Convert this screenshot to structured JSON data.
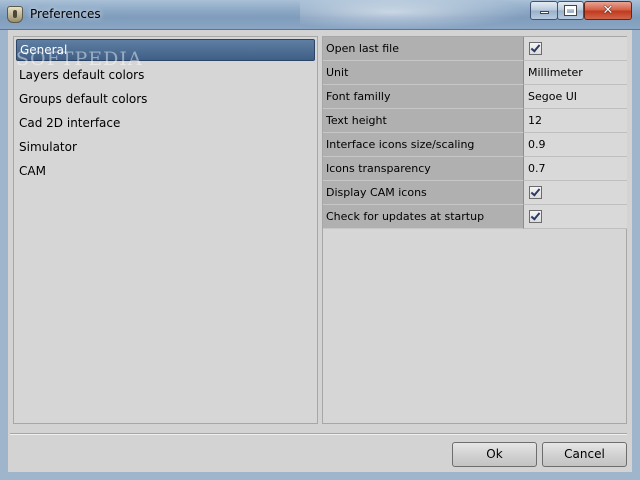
{
  "window": {
    "title": "Preferences",
    "app_icon": "app-icon",
    "controls": {
      "minimize": "minimize-icon",
      "maximize": "maximize-icon",
      "close": "close-icon"
    }
  },
  "categories": [
    {
      "label": "General",
      "selected": true
    },
    {
      "label": "Layers default colors",
      "selected": false
    },
    {
      "label": "Groups default colors",
      "selected": false
    },
    {
      "label": "Cad 2D interface",
      "selected": false
    },
    {
      "label": "Simulator",
      "selected": false
    },
    {
      "label": "CAM",
      "selected": false
    }
  ],
  "properties": [
    {
      "label": "Open last file",
      "type": "checkbox",
      "checked": true
    },
    {
      "label": "Unit",
      "type": "text",
      "value": "Millimeter"
    },
    {
      "label": "Font familly",
      "type": "text",
      "value": "Segoe UI"
    },
    {
      "label": "Text height",
      "type": "text",
      "value": "12"
    },
    {
      "label": "Interface icons size/scaling",
      "type": "text",
      "value": "0.9"
    },
    {
      "label": "Icons transparency",
      "type": "text",
      "value": "0.7"
    },
    {
      "label": "Display CAM icons",
      "type": "checkbox",
      "checked": true
    },
    {
      "label": "Check for updates at startup",
      "type": "checkbox",
      "checked": true
    }
  ],
  "buttons": {
    "ok": "Ok",
    "cancel": "Cancel"
  },
  "watermark": "SOFTPEDIA",
  "colors": {
    "selection": "#4a6a93",
    "label_cell": "#b0b0b0",
    "value_cell": "#d9d9d9",
    "background": "#d3d3d3"
  }
}
